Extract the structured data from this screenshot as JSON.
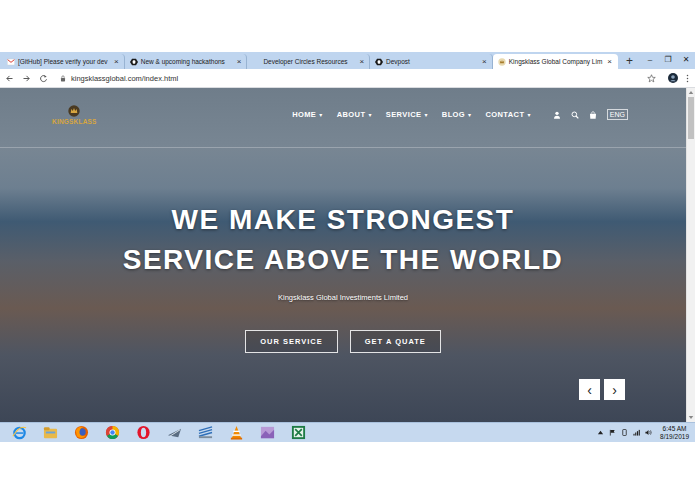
{
  "browser": {
    "tabs": [
      {
        "label": "[GitHub] Please verify your dev",
        "selected": false
      },
      {
        "label": "New & upcoming hackathons",
        "selected": false
      },
      {
        "label": "Developer Circles Resources",
        "selected": false
      },
      {
        "label": "Devpost",
        "selected": false
      },
      {
        "label": "Kingsklass Global Company Lim",
        "selected": true
      }
    ],
    "tab_close": "×",
    "new_tab": "+",
    "window_controls": [
      "–",
      "❐",
      "✕"
    ],
    "address": "kingsklassglobal.com/index.html"
  },
  "site": {
    "logo": "KINGSKLASS",
    "nav": [
      "HOME",
      "ABOUT",
      "SERVICE",
      "BLOG",
      "CONTACT"
    ],
    "nav_caret": "▾",
    "language": "ENG",
    "hero": {
      "title": [
        "WE MAKE STRONGEST",
        "SERVICE ABOVE THE WORLD"
      ],
      "subtitle": "Kingsklass Global Investiments Limited",
      "buttons": [
        "OUR SERVICE",
        "GET A QUATE"
      ],
      "prev": "‹",
      "next": "›"
    }
  },
  "taskbar": {
    "time": "6:45 AM",
    "date": "8/19/2019"
  }
}
